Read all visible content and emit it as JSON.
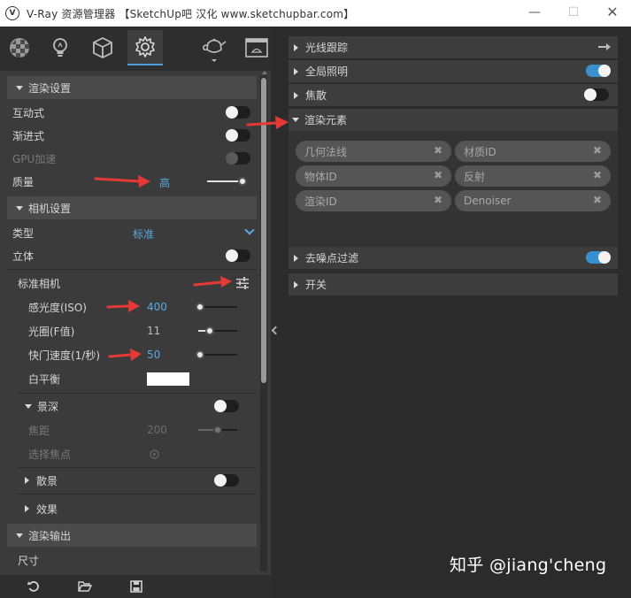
{
  "titlebar": {
    "title": "V-Ray 资源管理器 【SketchUp吧 汉化 www.sketchupbar.com】",
    "min": "—",
    "max": "☐",
    "close": "✕"
  },
  "tabs": [
    {
      "icon": "materials-icon"
    },
    {
      "icon": "lights-icon"
    },
    {
      "icon": "geometry-icon"
    },
    {
      "icon": "settings-icon",
      "active": true
    },
    {
      "icon": "render-teapot-icon"
    },
    {
      "icon": "frame-buffer-icon"
    }
  ],
  "left": {
    "render_settings": {
      "header": "渲染设置",
      "interactive": {
        "label": "互动式",
        "on": false
      },
      "progressive": {
        "label": "渐进式",
        "on": false
      },
      "gpu": {
        "label": "GPU加速",
        "on": false
      },
      "quality": {
        "label": "质量",
        "value": "高",
        "level": 0.9
      }
    },
    "camera_settings": {
      "header": "相机设置",
      "type": {
        "label": "类型",
        "value": "标准"
      },
      "stereo": {
        "label": "立体",
        "on": false
      },
      "standard_camera": {
        "label": "标准相机"
      },
      "iso": {
        "label": "感光度(ISO)",
        "value": "400",
        "level": 0.05
      },
      "fnumber": {
        "label": "光圈(F值)",
        "value": "11",
        "level": 0.3
      },
      "shutter": {
        "label": "快门速度(1/秒)",
        "value": "50",
        "level": 0.05
      },
      "white_balance": {
        "label": "白平衡",
        "color": "#ffffff"
      },
      "dof": {
        "header": "景深",
        "on": false
      },
      "focus_distance": {
        "label": "焦距",
        "value": "200",
        "level": 0.5
      },
      "pick_focus": {
        "label": "选择焦点"
      },
      "bokeh": {
        "header": "散景",
        "on": false
      },
      "effects": {
        "header": "效果"
      }
    },
    "render_output": {
      "header": "渲染输出",
      "size": {
        "label": "尺寸"
      }
    }
  },
  "right": {
    "raytrace": {
      "label": "光线跟踪"
    },
    "gi": {
      "label": "全局照明",
      "on": true
    },
    "caustics": {
      "label": "焦散",
      "on": false
    },
    "render_elements": {
      "label": "渲染元素",
      "chips": [
        "几何法线",
        "材质ID",
        "物体ID",
        "反射",
        "渲染ID",
        "Denoiser"
      ]
    },
    "denoiser": {
      "label": "去噪点过滤",
      "on": true
    },
    "switches": {
      "label": "开关"
    }
  },
  "watermark": "知乎 @jiang'cheng",
  "colors": {
    "accent": "#3a8fd0",
    "value_blue": "#5aa9e0",
    "annotation_red": "#e53935"
  }
}
